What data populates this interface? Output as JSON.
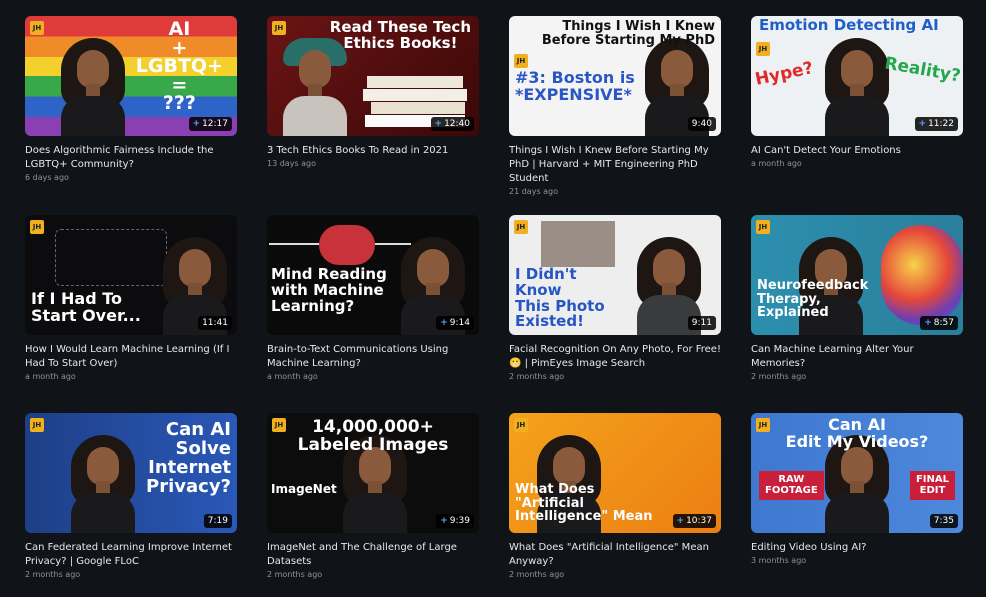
{
  "videos": [
    {
      "thumb_text": "AI\n+\nLGBTQ+\n=\n???",
      "duration": "12:17",
      "title": "Does Algorithmic Fairness Include the LGBTQ+ Community?",
      "age": "6 days ago"
    },
    {
      "thumb_text": "Read These Tech\nEthics Books!",
      "duration": "12:40",
      "title": "3 Tech Ethics Books To Read in 2021",
      "age": "13 days ago"
    },
    {
      "thumb_text": "Things I Wish I Knew\nBefore Starting My PhD",
      "thumb_text2": "#3: Boston is\n*EXPENSIVE*",
      "duration": "9:40",
      "title": "Things I Wish I Knew Before Starting My PhD | Harvard + MIT Engineering PhD Student",
      "age": "21 days ago"
    },
    {
      "thumb_text": "Emotion Detecting AI",
      "thumb_text2": "Hype?",
      "thumb_text3": "Reality?",
      "duration": "11:22",
      "title": "AI Can't Detect Your Emotions",
      "age": "a month ago"
    },
    {
      "thumb_text": "If I Had To\nStart Over...",
      "duration": "11:41",
      "title": "How I Would Learn Machine Learning (If I Had To Start Over)",
      "age": "a month ago"
    },
    {
      "thumb_text": "Mind Reading\nwith Machine\nLearning?",
      "duration": "9:14",
      "title": "Brain-to-Text Communications Using Machine Learning?",
      "age": "a month ago"
    },
    {
      "thumb_text": "I Didn't\nKnow\nThis Photo\nExisted!",
      "duration": "9:11",
      "title": "Facial Recognition On Any Photo, For Free! 😬 | PimEyes Image Search",
      "age": "2 months ago"
    },
    {
      "thumb_text": "Neurofeedback\nTherapy,\nExplained",
      "duration": "8:57",
      "title": "Can Machine Learning Alter Your Memories?",
      "age": "2 months ago"
    },
    {
      "thumb_text": "Can AI\nSolve\nInternet\nPrivacy?",
      "duration": "7:19",
      "title": "Can Federated Learning Improve Internet Privacy? | Google FLoC",
      "age": "2 months ago"
    },
    {
      "thumb_text": "14,000,000+\nLabeled Images",
      "thumb_text2": "ImageNet",
      "duration": "9:39",
      "title": "ImageNet and The Challenge of Large Datasets",
      "age": "2 months ago"
    },
    {
      "thumb_text": "What Does\n\"Artificial\nIntelligence\" Mean",
      "duration": "10:37",
      "title": "What Does \"Artificial Intelligence\" Mean Anyway?",
      "age": "2 months ago"
    },
    {
      "thumb_text": "Can AI\nEdit My Videos?",
      "thumb_text2": "RAW\nFOOTAGE",
      "thumb_text3": "FINAL\nEDIT",
      "duration": "7:35",
      "title": "Editing Video Using AI?",
      "age": "3 months ago"
    }
  ],
  "logo_label": "JH",
  "colors": {
    "background": "#101419",
    "accent_yellow": "#f2b01e",
    "duration_plus": "#58a6ff"
  }
}
